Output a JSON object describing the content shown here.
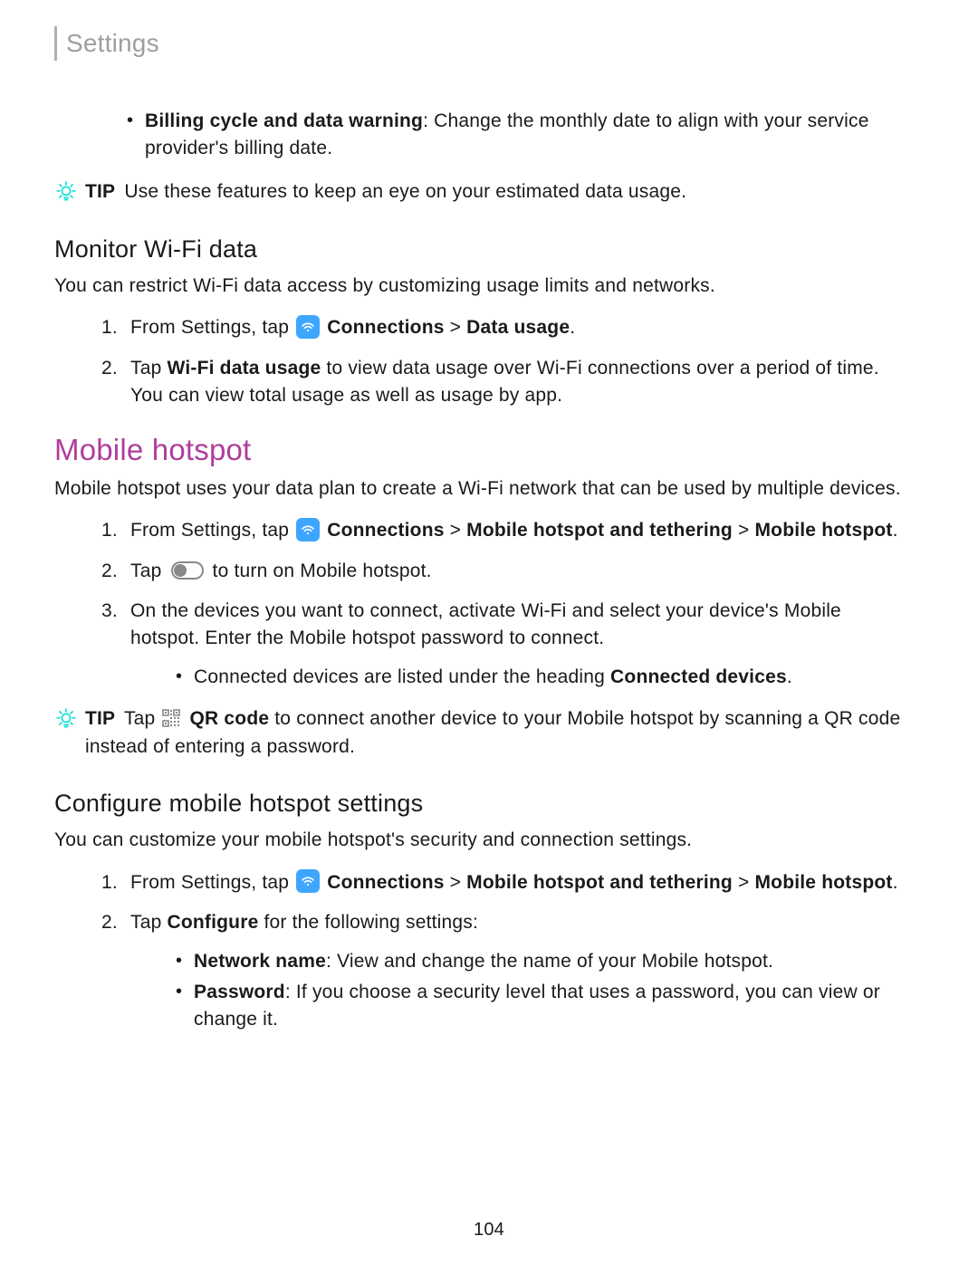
{
  "header": {
    "title": "Settings"
  },
  "billing_bullet": {
    "label": "Billing cycle and data warning",
    "text": ": Change the monthly date to align with your service provider's billing date."
  },
  "tip1": {
    "label": "TIP",
    "text": "Use these features to keep an eye on your estimated data usage."
  },
  "monitor": {
    "heading": "Monitor Wi-Fi data",
    "intro": "You can restrict Wi-Fi data access by customizing usage limits and networks.",
    "step1_pre": "From Settings, tap ",
    "step1_b1": "Connections",
    "step1_sep": " > ",
    "step1_b2": "Data usage",
    "step1_post": ".",
    "step2_pre": "Tap ",
    "step2_b1": "Wi-Fi data usage",
    "step2_post": " to view data usage over Wi-Fi connections over a period of time. You can view total usage as well as usage by app."
  },
  "hotspot": {
    "heading": "Mobile hotspot",
    "intro": "Mobile hotspot uses your data plan to create a Wi-Fi network that can be used by multiple devices.",
    "step1_pre": "From Settings, tap ",
    "step1_b1": "Connections",
    "step1_sep1": " > ",
    "step1_b2": "Mobile hotspot and tethering",
    "step1_sep2": " > ",
    "step1_b3": "Mobile hotspot",
    "step1_post": ".",
    "step2_pre": "Tap ",
    "step2_post": " to turn on Mobile hotspot.",
    "step3": "On the devices you want to connect, activate Wi-Fi and select your device's Mobile hotspot. Enter the Mobile hotspot password to connect.",
    "step3_sub_pre": "Connected devices are listed under the heading ",
    "step3_sub_b": "Connected devices",
    "step3_sub_post": "."
  },
  "tip2": {
    "label": "TIP",
    "pre": "Tap ",
    "b1": "QR code",
    "post": " to connect another device to your Mobile hotspot by scanning a QR code instead of entering a password."
  },
  "configure": {
    "heading": "Configure mobile hotspot settings",
    "intro": "You can customize your mobile hotspot's security and connection settings.",
    "step1_pre": "From Settings, tap ",
    "step1_b1": "Connections",
    "step1_sep1": " > ",
    "step1_b2": "Mobile hotspot and tethering",
    "step1_sep2": " > ",
    "step1_b3": "Mobile hotspot",
    "step1_post": ".",
    "step2_pre": "Tap ",
    "step2_b1": "Configure",
    "step2_post": " for the following settings:",
    "sub1_b": "Network name",
    "sub1_text": ": View and change the name of your Mobile hotspot.",
    "sub2_b": "Password",
    "sub2_text": ": If you choose a security level that uses a password, you can view or change it."
  },
  "page_number": "104"
}
